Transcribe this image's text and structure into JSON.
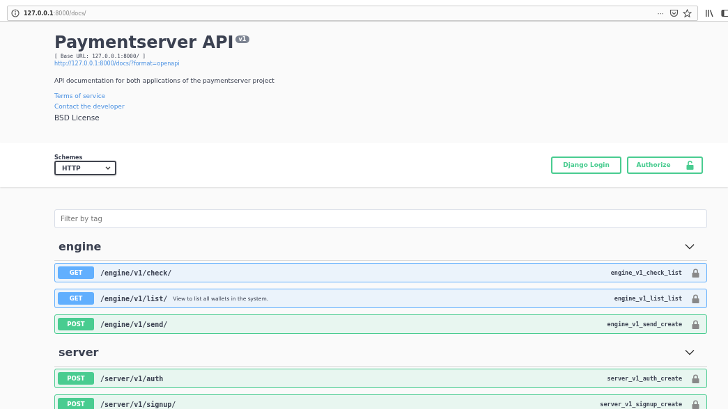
{
  "browser": {
    "url_host": "127.0.0.1",
    "url_path": ":8000/docs/",
    "menu": "···"
  },
  "info": {
    "title": "Paymentserver API",
    "version": "v1",
    "base_url": "[ Base URL: 127.0.0.1:8000/ ]",
    "spec_link": "http://127.0.0.1:8000/docs/?format=openapi",
    "description": "API documentation for both applications of the paymentserver project",
    "terms": "Terms of service",
    "contact": "Contact the developer",
    "license": "BSD License"
  },
  "schemes": {
    "label": "Schemes",
    "value": "HTTP"
  },
  "buttons": {
    "login": "Django Login",
    "authorize": "Authorize"
  },
  "filter": {
    "placeholder": "Filter by tag"
  },
  "tags": [
    {
      "name": "engine",
      "expanded": true,
      "operations": [
        {
          "method": "GET",
          "path": "/engine/v1/check/",
          "operation_id": "engine_v1_check_list"
        },
        {
          "method": "GET",
          "path": "/engine/v1/list/",
          "summary": "View to list all wallets in the system.",
          "operation_id": "engine_v1_list_list"
        },
        {
          "method": "POST",
          "path": "/engine/v1/send/",
          "operation_id": "engine_v1_send_create"
        }
      ]
    },
    {
      "name": "server",
      "expanded": true,
      "operations": [
        {
          "method": "POST",
          "path": "/server/v1/auth",
          "operation_id": "server_v1_auth_create"
        },
        {
          "method": "POST",
          "path": "/server/v1/signup/",
          "operation_id": "server_v1_signup_create"
        }
      ]
    }
  ]
}
